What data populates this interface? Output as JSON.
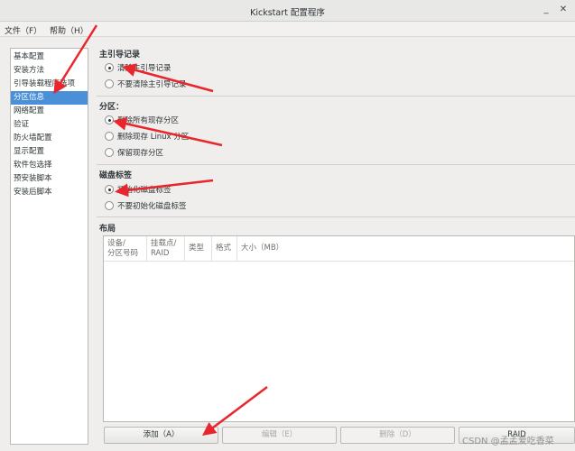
{
  "window": {
    "title": "Kickstart 配置程序",
    "minimize_glyph": "_",
    "close_glyph": "✕"
  },
  "menu": {
    "file": "文件（F）",
    "help": "帮助（H）"
  },
  "sidebar": {
    "items": [
      {
        "label": "基本配置"
      },
      {
        "label": "安装方法"
      },
      {
        "label": "引导装载程序选项"
      },
      {
        "label": "分区信息",
        "selected": true
      },
      {
        "label": "网络配置"
      },
      {
        "label": "验证"
      },
      {
        "label": "防火墙配置"
      },
      {
        "label": "显示配置"
      },
      {
        "label": "软件包选择"
      },
      {
        "label": "预安装脚本"
      },
      {
        "label": "安装后脚本"
      }
    ]
  },
  "mbr": {
    "title": "主引导记录",
    "options": [
      {
        "label": "清除主引导记录",
        "checked": true
      },
      {
        "label": "不要清除主引导记录",
        "checked": false
      }
    ]
  },
  "partitions": {
    "title": "分区：",
    "options": [
      {
        "label": "删除所有现存分区",
        "checked": true
      },
      {
        "label": "删除现存 Linux 分区",
        "checked": false
      },
      {
        "label": "保留现存分区",
        "checked": false
      }
    ]
  },
  "disklabel": {
    "title": "磁盘标签",
    "options": [
      {
        "label": "初始化磁盘标签",
        "checked": true
      },
      {
        "label": "不要初始化磁盘标签",
        "checked": false
      }
    ]
  },
  "layout": {
    "title": "布局",
    "columns": [
      "设备/分区号码",
      "挂载点/RAID",
      "类型",
      "格式",
      "大小（MB）"
    ],
    "col_lines": [
      [
        "设备/",
        "分区号码"
      ],
      [
        "挂载点/",
        "RAID"
      ],
      [
        "类型"
      ],
      [
        "格式"
      ],
      [
        "大小（MB）"
      ]
    ]
  },
  "buttons": {
    "add": "添加（A）",
    "edit": "编辑（E）",
    "delete": "删除（D）",
    "raid": "RAID"
  },
  "watermark": "CSDN @孟孟爱吃香菜",
  "colors": {
    "selection": "#4a90d9",
    "arrow": "#e8262b",
    "background": "#efeeed"
  }
}
